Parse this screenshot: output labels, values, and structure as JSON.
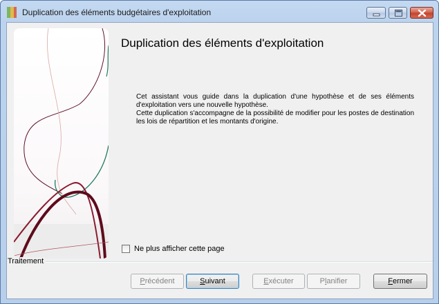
{
  "window": {
    "title": "Duplication des éléments budgétaires d'exploitation"
  },
  "titlebar_buttons": {
    "minimize_icon": "minimize-icon",
    "maximize_icon": "maximize-icon",
    "close_icon": "close-icon"
  },
  "main": {
    "heading": "Duplication des éléments d'exploitation",
    "description_1": "Cet assistant vous guide dans la duplication d'une hypothèse et de ses éléments d'exploitation vers une nouvelle hypothèse.",
    "description_2": "Cette duplication s'accompagne de la possibilité de modifier pour les postes de destination les lois de répartition et les montants d'origine.",
    "checkbox_label": "Ne plus afficher cette page",
    "checkbox_checked": false
  },
  "footer": {
    "group_label": "Traitement",
    "buttons": {
      "previous": {
        "pre": "",
        "accel": "P",
        "post": "récédent"
      },
      "next": {
        "pre": "",
        "accel": "S",
        "post": "uivant"
      },
      "execute": {
        "pre": "",
        "accel": "E",
        "post": "xécuter"
      },
      "plan": {
        "pre": "P",
        "accel": "l",
        "post": "anifier"
      },
      "close": {
        "pre": "",
        "accel": "F",
        "post": "ermer"
      }
    }
  },
  "colors": {
    "accent_default_border": "#3c7fb1",
    "side_curve_dark_red": "#6e0f22",
    "side_curve_green": "#1f7a5e"
  }
}
